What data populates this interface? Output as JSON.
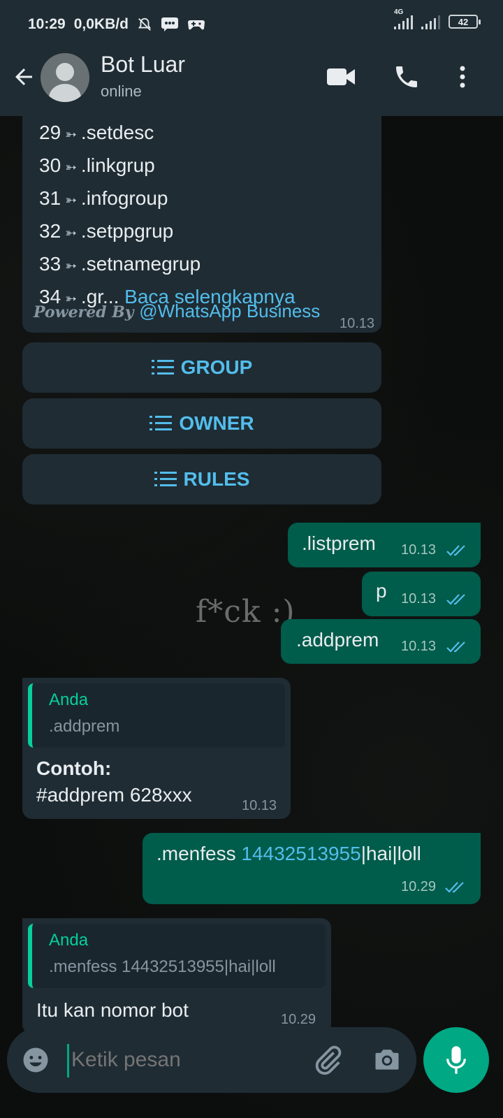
{
  "status_bar": {
    "time": "10:29",
    "data_rate": "0,0KB/d",
    "network_label": "4G",
    "battery": "42"
  },
  "header": {
    "contact_name": "Bot Luar",
    "status": "online"
  },
  "menu_message": {
    "rows": [
      {
        "num": "29",
        "cmd": ".setdesc"
      },
      {
        "num": "30",
        "cmd": ".linkgrup"
      },
      {
        "num": "31",
        "cmd": ".infogroup"
      },
      {
        "num": "32",
        "cmd": ".setppgrup"
      },
      {
        "num": "33",
        "cmd": ".setnamegrup"
      },
      {
        "num": "34",
        "cmd": ".gr..."
      }
    ],
    "arrow": "➳",
    "read_more": "Baca selengkapnya",
    "powered_prefix": "Powered By",
    "powered_handle": "@WhatsApp Business",
    "time": "10.13"
  },
  "buttons": [
    {
      "label": "GROUP"
    },
    {
      "label": "OWNER"
    },
    {
      "label": "RULES"
    }
  ],
  "messages": {
    "out1": {
      "text": ".listprem",
      "time": "10.13"
    },
    "out2": {
      "text": "p",
      "time": "10.13"
    },
    "out3": {
      "text": ".addprem",
      "time": "10.13"
    },
    "in1": {
      "quote_name": "Anda",
      "quote_text": ".addprem",
      "line1": "Contoh:",
      "line2": "#addprem 628xxx",
      "time": "10.13"
    },
    "out4": {
      "prefix": ".menfess ",
      "number": "14432513955",
      "suffix": "|hai|loll",
      "time": "10.29"
    },
    "in2": {
      "quote_name": "Anda",
      "quote_text": ".menfess 14432513955|hai|loll",
      "text": "Itu kan nomor bot",
      "time": "10.29"
    }
  },
  "watermark": "f*ck :)",
  "input": {
    "placeholder": "Ketik pesan"
  },
  "colors": {
    "header_bg": "#1f2c34",
    "incoming_bubble": "#1f2c34",
    "outgoing_bubble": "#005c4b",
    "accent": "#00a884",
    "link": "#53bdeb"
  }
}
